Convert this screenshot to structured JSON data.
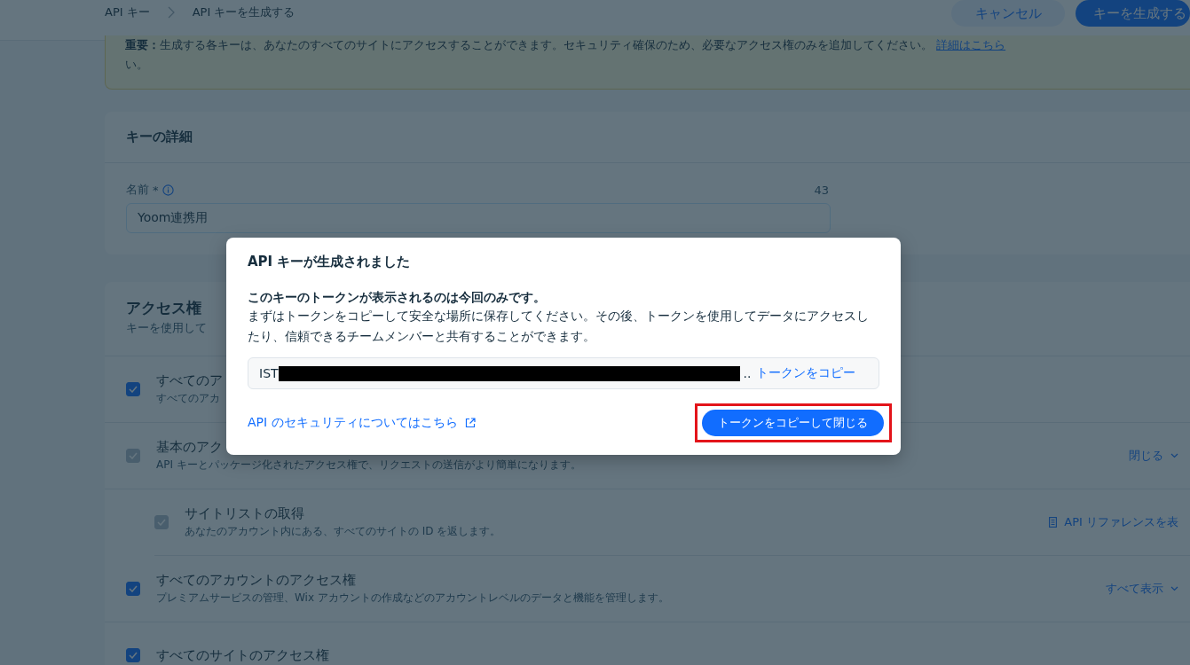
{
  "breadcrumb": [
    {
      "label": "API キー"
    },
    {
      "label": "API キーを生成する"
    }
  ],
  "header_buttons": [
    {
      "label": "キャンセル",
      "kind": "secondary"
    },
    {
      "label": "キーを生成する",
      "kind": "primary"
    }
  ],
  "notice": {
    "text": "**重要：**生成する各キーは、あなたのすべてのサイトにアクセスすることができます。セキュリティ確保のため、必要なアクセス権のみを追加してください。",
    "link": "詳細はこちら",
    "tail": "い。"
  },
  "key_details": {
    "title": "キーの詳細",
    "name_field": {
      "label": "名前",
      "required": "*",
      "counter": "43",
      "value": "Yoom連携用"
    }
  },
  "access": {
    "title": "アクセス権",
    "subtitle": "キーを使用して",
    "rows": [
      {
        "label": "すべてのア",
        "description": "すべてのアカ",
        "checked": true,
        "disabled": false,
        "kind": "top"
      },
      {
        "label": "基本のアク",
        "description": "API キーとパッケージ化されたアクセス権で、リクエストの送信がより簡単になります。",
        "checked": true,
        "disabled": true,
        "kind": "top",
        "action": {
          "kind": "toggle",
          "text": "閉じる"
        }
      },
      {
        "label": "サイトリストの取得",
        "description": "あなたのアカウント内にある、すべてのサイトの ID を返します。",
        "checked": true,
        "disabled": true,
        "kind": "nested",
        "action": {
          "kind": "reference",
          "text": "API リファレンスを表"
        }
      },
      {
        "label": "すべてのアカウントのアクセス権",
        "description": "プレミアムサービスの管理、Wix アカウントの作成などのアカウントレベルのデータと機能を管理します。",
        "checked": true,
        "disabled": false,
        "kind": "top",
        "action": {
          "kind": "toggle",
          "text": "すべて表示"
        }
      },
      {
        "label": "すべてのサイトのアクセス権",
        "checked": true,
        "disabled": false,
        "kind": "top"
      }
    ]
  },
  "dialog": {
    "title": "API キーが生成されました",
    "lead": "このキーのトークンが表示されるのは今回のみです。",
    "body": "まずはトークンをコピーして安全な場所に保存してください。その後、トークンを使用してデータにアクセスしたり、信頼できるチームメンバーと共有することができます。",
    "token": {
      "prefix": "IST",
      "suffix": "..",
      "copy": "トークンをコピー"
    },
    "link": "API のセキュリティについてはこちら",
    "primary": "トークンをコピーして閉じる",
    "highlighted": true
  }
}
